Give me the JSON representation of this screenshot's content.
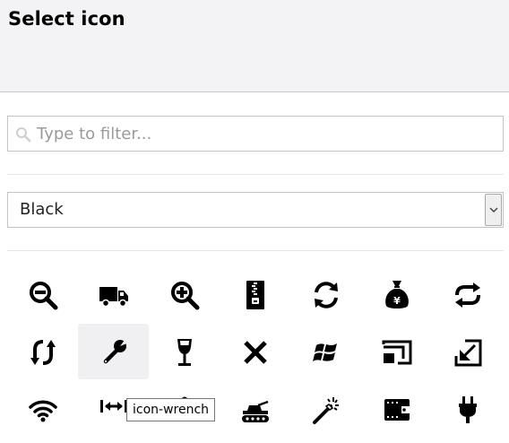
{
  "header": {
    "title": "Select icon"
  },
  "filter": {
    "placeholder": "Type to filter...",
    "value": "",
    "icon": "search-icon"
  },
  "color_select": {
    "selected": "Black"
  },
  "tooltip": {
    "text": "icon-wrench"
  },
  "icons": [
    {
      "name": "zoom-out-icon"
    },
    {
      "name": "truck-icon"
    },
    {
      "name": "zoom-in-icon"
    },
    {
      "name": "zip-file-icon"
    },
    {
      "name": "refresh-icon"
    },
    {
      "name": "money-bag-icon"
    },
    {
      "name": "sync-icon"
    },
    {
      "name": "vertical-sync-icon"
    },
    {
      "name": "wrench-icon",
      "selected": true
    },
    {
      "name": "wine-glass-icon"
    },
    {
      "name": "close-x-icon"
    },
    {
      "name": "windows-logo-icon"
    },
    {
      "name": "screen-cast-icon"
    },
    {
      "name": "window-minimize-icon"
    },
    {
      "name": "wifi-icon"
    },
    {
      "name": "width-icon"
    },
    {
      "name": "weight-icon"
    },
    {
      "name": "tank-icon"
    },
    {
      "name": "magic-wand-icon"
    },
    {
      "name": "wallet-icon"
    },
    {
      "name": "plug-icon"
    }
  ],
  "colors": {
    "icon": "#000000",
    "header_bg": "#f3f3f5",
    "selected_bg": "#f0f0f2"
  }
}
